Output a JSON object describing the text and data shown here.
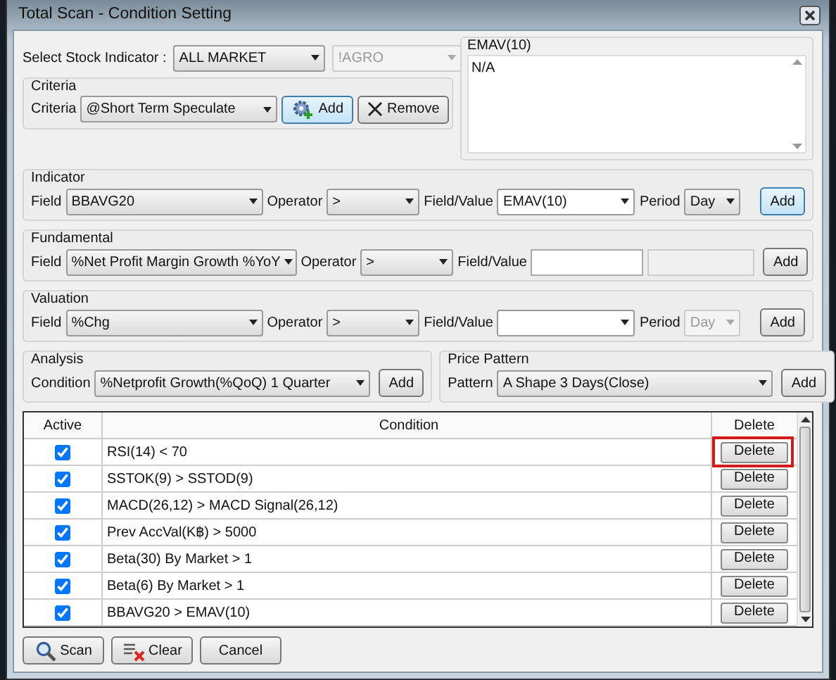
{
  "window": {
    "title": "Total Scan - Condition Setting"
  },
  "stock_indicator": {
    "label": "Select Stock Indicator :",
    "value": "ALL MARKET",
    "sub_value": "!AGRO",
    "sub_disabled": true
  },
  "criteria": {
    "title": "Criteria",
    "label": "Criteria",
    "value": "@Short Term Speculate",
    "buttons": [
      {
        "label": "Add",
        "kind": "add"
      },
      {
        "label": "Remove",
        "kind": "remove"
      }
    ]
  },
  "preview": {
    "title": "EMAV(10)",
    "text": "N/A"
  },
  "groups": [
    {
      "title": "Indicator",
      "fields": [
        {
          "label": "Field",
          "kind": "select",
          "value": "BBAVG20"
        },
        {
          "label": "Operator",
          "kind": "select",
          "value": ">"
        },
        {
          "label": "Field/Value",
          "kind": "select",
          "value": "EMAV(10)"
        },
        {
          "label": "Period",
          "kind": "select",
          "value": "Day",
          "disabled": false
        }
      ],
      "button": "Add"
    },
    {
      "title": "Fundamental",
      "fields": [
        {
          "label": "Field",
          "kind": "select",
          "value": "%Net Profit Margin Growth %YoY"
        },
        {
          "label": "Operator",
          "kind": "select",
          "value": ">"
        },
        {
          "label": "Field/Value",
          "kind": "input"
        },
        {
          "kind": "input",
          "disabled": true
        }
      ],
      "button": "Add"
    },
    {
      "title": "Valuation",
      "fields": [
        {
          "label": "Field",
          "kind": "select",
          "value": "%Chg"
        },
        {
          "label": "Operator",
          "kind": "select",
          "value": ">"
        },
        {
          "label": "Field/Value",
          "kind": "select"
        },
        {
          "label": "Period",
          "kind": "select",
          "value": "Day",
          "disabled": true
        }
      ],
      "button": "Add"
    }
  ],
  "half_groups": [
    {
      "title": "Analysis",
      "label": "Condition",
      "value": "%Netprofit Growth(%QoQ) 1 Quarter",
      "button": "Add"
    },
    {
      "title": "Price Pattern",
      "label": "Pattern",
      "value": "A Shape 3 Days(Close)",
      "button": "Add"
    }
  ],
  "table": {
    "columns": [
      "Active",
      "Condition",
      "Delete"
    ],
    "rows": [
      {
        "active": true,
        "condition": "RSI(14) < 70",
        "action": "Delete",
        "highlighted": true
      },
      {
        "active": true,
        "condition": "SSTOK(9) > SSTOD(9)",
        "action": "Delete",
        "highlighted": false
      },
      {
        "active": true,
        "condition": "MACD(26,12) > MACD Signal(26,12)",
        "action": "Delete",
        "highlighted": false
      },
      {
        "active": true,
        "condition": "Prev AccVal(K฿) > 5000",
        "action": "Delete",
        "highlighted": false
      },
      {
        "active": true,
        "condition": "Beta(30) By Market > 1",
        "action": "Delete",
        "highlighted": false
      },
      {
        "active": true,
        "condition": "Beta(6) By Market > 1",
        "action": "Delete",
        "highlighted": false
      },
      {
        "active": true,
        "condition": "BBAVG20 > EMAV(10)",
        "action": "Delete",
        "highlighted": false
      }
    ]
  },
  "buttons": [
    {
      "label": "Scan",
      "kind": "scan"
    },
    {
      "label": "Clear",
      "kind": "clear"
    },
    {
      "label": "Cancel",
      "kind": "plain"
    }
  ]
}
